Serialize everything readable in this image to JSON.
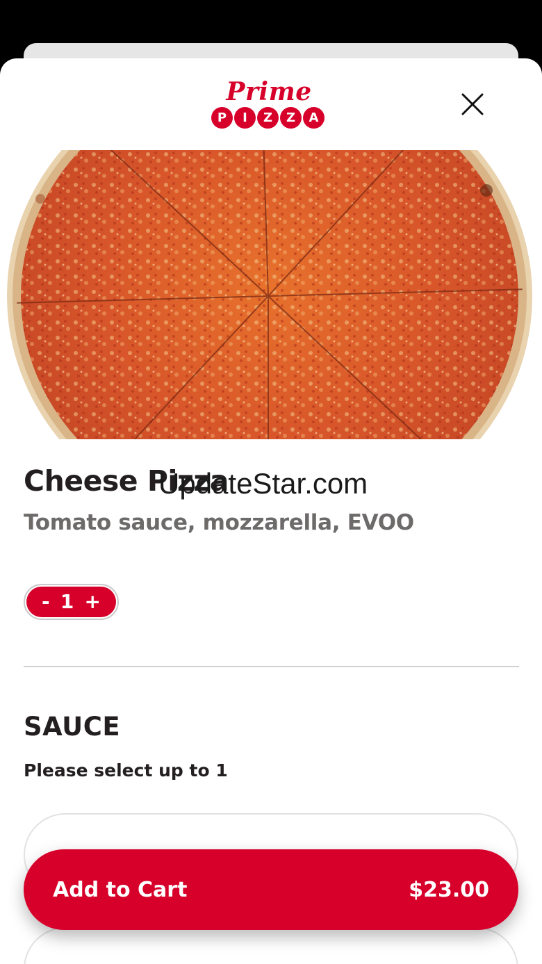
{
  "brand": {
    "script": "Prime",
    "letters": [
      "P",
      "I",
      "Z",
      "Z",
      "A"
    ]
  },
  "product": {
    "title": "Cheese Pizza",
    "description": "Tomato sauce, mozzarella, EVOO"
  },
  "watermark": "UpdateStar.com",
  "quantity": {
    "minus": "-",
    "value": "1",
    "plus": "+"
  },
  "section": {
    "title": "SAUCE",
    "subtitle": "Please select up to 1",
    "options": [
      {
        "label": ""
      },
      {
        "label": ""
      }
    ]
  },
  "cart": {
    "label": "Add to Cart",
    "price": "$23.00"
  },
  "colors": {
    "brand_red": "#d7002a",
    "text_dark": "#231f20",
    "text_muted": "#6d6a6a"
  },
  "icons": {
    "close": "close-icon"
  }
}
